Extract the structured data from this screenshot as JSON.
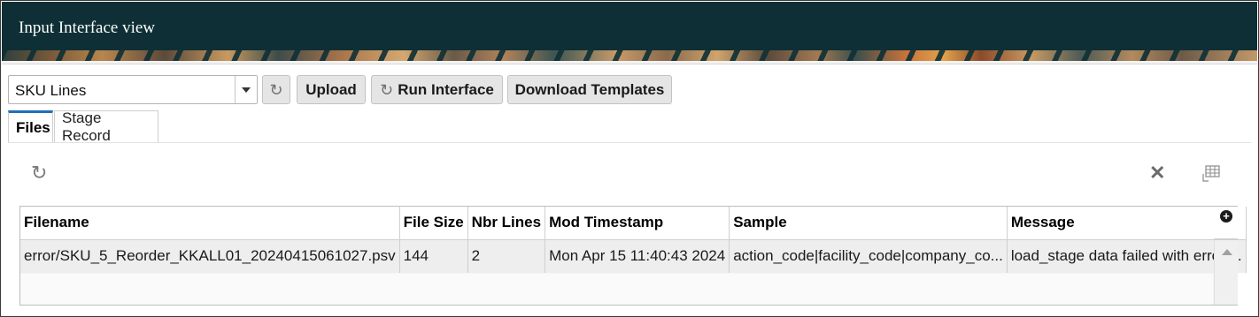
{
  "header": {
    "title": "Input Interface view"
  },
  "interface_select": {
    "value": "SKU Lines"
  },
  "toolbar": {
    "upload_label": "Upload",
    "run_label": "Run Interface",
    "download_label": "Download Templates"
  },
  "tabs": [
    {
      "label": "Files",
      "active": true
    },
    {
      "label": "Stage Record",
      "active": false
    }
  ],
  "icons": {
    "refresh": "refresh-icon",
    "close": "close-icon",
    "grid": "table-settings-icon",
    "add": "add-column-icon",
    "scroll_up": "scroll-up-icon"
  },
  "table": {
    "columns": [
      "Filename",
      "File Size",
      "Nbr Lines",
      "Mod Timestamp",
      "Sample",
      "Message"
    ],
    "rows": [
      [
        "error/SKU_5_Reorder_KKALL01_20240415061027.psv",
        "144",
        "2",
        "Mon Apr 15 11:40:43 2024",
        "action_code|facility_code|company_co...",
        "load_stage data failed with error ..."
      ]
    ]
  },
  "colors": {
    "header_bg": "#0e2f35",
    "active_tab_accent": "#1f6fb5",
    "button_bg": "#e5e5e5"
  }
}
